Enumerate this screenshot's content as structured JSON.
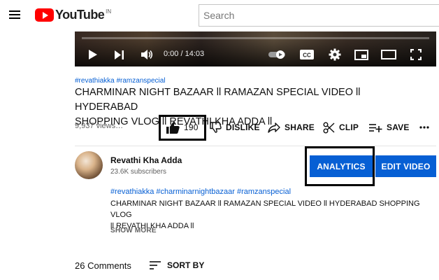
{
  "header": {
    "logo_text": "YouTube",
    "country_code": "IN",
    "search_placeholder": "Search"
  },
  "player": {
    "time": "0:00 / 14:03"
  },
  "video": {
    "hashtags": "#revathiakka #ramzanspecial",
    "title_line1": "CHARMINAR NIGHT BAZAAR ll RAMAZAN SPECIAL VIDEO ll HYDERABAD",
    "title_line2": "SHOPPING VLOG ll REVATHI KHA ADDA ll",
    "views": "9,937 views…"
  },
  "actions": {
    "like_count": "190",
    "dislike_label": "DISLIKE",
    "share_label": "SHARE",
    "clip_label": "CLIP",
    "save_label": "SAVE"
  },
  "channel": {
    "name": "Revathi Kha Adda",
    "subscribers": "23.6K subscribers",
    "analytics_label": "ANALYTICS",
    "edit_video_label": "EDIT VIDEO"
  },
  "description": {
    "hashtags": "#revathiakka #charminarnightbazaar #ramzanspecial",
    "line1": "CHARMINAR NIGHT BAZAAR ll RAMAZAN SPECIAL VIDEO ll HYDERABAD SHOPPING VLOG",
    "line2": "ll REVATHI KHA ADDA ll",
    "show_more": "SHOW MORE"
  },
  "comments": {
    "count_label": "26 Comments",
    "sort_label": "SORT BY"
  },
  "colors": {
    "brand_red": "#ff0000",
    "link_blue": "#065fd4",
    "button_blue": "#065fd4"
  }
}
